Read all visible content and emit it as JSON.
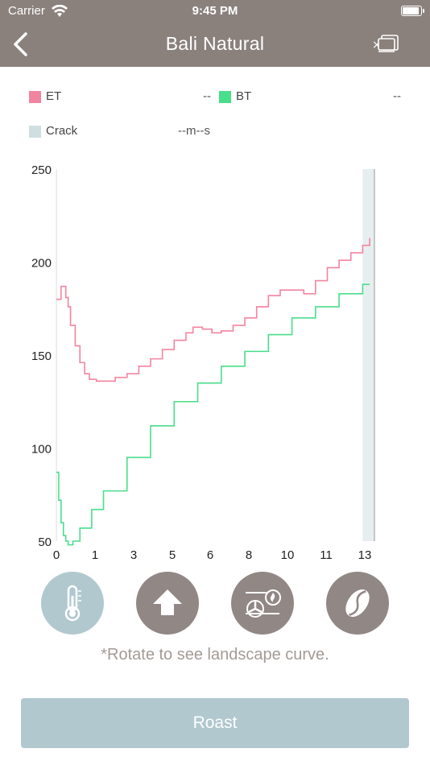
{
  "status_bar": {
    "carrier": "Carrier",
    "time": "9:45 PM"
  },
  "nav": {
    "title": "Bali Natural"
  },
  "legend": {
    "et": {
      "label": "ET",
      "value": "--",
      "color": "#f3849f"
    },
    "bt": {
      "label": "BT",
      "value": "--",
      "color": "#49de8a"
    },
    "crack": {
      "label": "Crack",
      "value": "--m--s",
      "color": "#cfdfe1"
    }
  },
  "chart_data": {
    "type": "line",
    "x_ticks": [
      "0",
      "1",
      "3",
      "5",
      "6",
      "8",
      "10",
      "11",
      "13"
    ],
    "y_ticks": [
      "250",
      "200",
      "150",
      "100",
      "50"
    ],
    "xlim": [
      0,
      13.5
    ],
    "ylim": [
      50,
      250
    ],
    "series": [
      {
        "name": "ET",
        "color": "#f3849f",
        "x": [
          0,
          0.2,
          0.4,
          0.5,
          0.6,
          0.8,
          1.0,
          1.2,
          1.4,
          1.7,
          2.0,
          2.5,
          3.0,
          3.5,
          4.0,
          4.5,
          5.0,
          5.5,
          5.8,
          6.2,
          6.6,
          7.0,
          7.5,
          8.0,
          8.5,
          9.0,
          9.5,
          10.0,
          10.5,
          11.0,
          11.5,
          12.0,
          12.5,
          13.0,
          13.3
        ],
        "y": [
          180,
          187,
          181,
          176,
          166,
          155,
          146,
          140,
          137,
          136,
          136,
          138,
          140,
          144,
          148,
          153,
          158,
          162,
          165,
          164,
          162,
          163,
          166,
          170,
          176,
          182,
          185,
          185,
          183,
          190,
          197,
          201,
          205,
          209,
          213
        ]
      },
      {
        "name": "BT",
        "color": "#49de8a",
        "x": [
          0,
          0.1,
          0.2,
          0.3,
          0.4,
          0.5,
          0.7,
          1.0,
          1.5,
          2.0,
          3.0,
          4.0,
          5.0,
          6.0,
          7.0,
          8.0,
          9.0,
          10.0,
          11.0,
          12.0,
          13.0,
          13.3
        ],
        "y": [
          87,
          72,
          60,
          53,
          50,
          48,
          50,
          57,
          67,
          77,
          95,
          112,
          125,
          135,
          144,
          152,
          161,
          170,
          176,
          183,
          188,
          188
        ]
      }
    ],
    "crack_band": [
      13.0,
      13.5
    ]
  },
  "actions": {
    "temperature": {
      "icon": "thermometer-icon",
      "color": "#b1c8cf"
    },
    "up": {
      "icon": "up-arrow-icon",
      "color": "#918784"
    },
    "fan": {
      "icon": "fan-heat-icon",
      "color": "#918784"
    },
    "bean": {
      "icon": "coffee-bean-icon",
      "color": "#918784"
    }
  },
  "hint": "*Rotate to see landscape curve.",
  "roast_button": "Roast"
}
